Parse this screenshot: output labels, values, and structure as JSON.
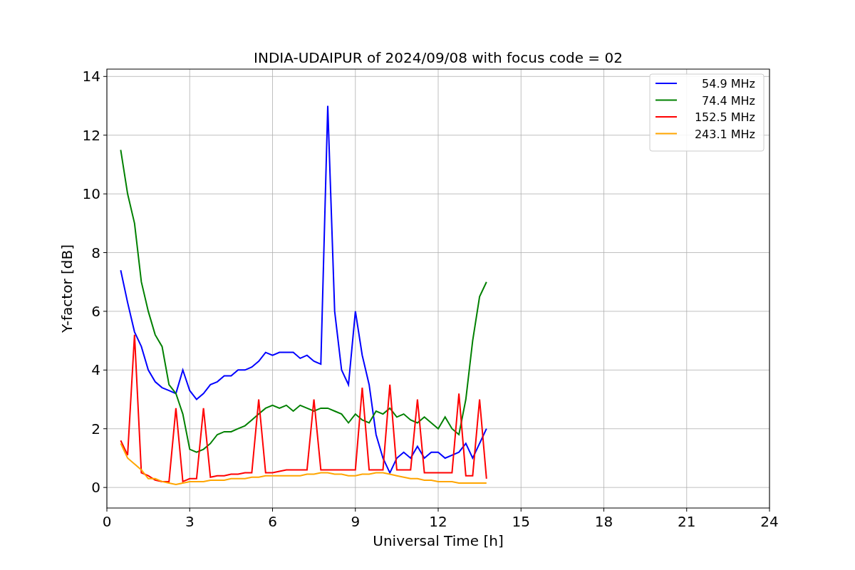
{
  "chart_data": {
    "type": "line",
    "title": "INDIA-UDAIPUR of 2024/09/08 with focus code = 02",
    "xlabel": "Universal Time [h]",
    "ylabel": "Y-factor [dB]",
    "x": [
      0.5,
      0.75,
      1.0,
      1.25,
      1.5,
      1.75,
      2.0,
      2.25,
      2.5,
      2.75,
      3.0,
      3.25,
      3.5,
      3.75,
      4.0,
      4.25,
      4.5,
      4.75,
      5.0,
      5.25,
      5.5,
      5.75,
      6.0,
      6.25,
      6.5,
      6.75,
      7.0,
      7.25,
      7.5,
      7.75,
      8.0,
      8.25,
      8.5,
      8.75,
      9.0,
      9.25,
      9.5,
      9.75,
      10.0,
      10.25,
      10.5,
      10.75,
      11.0,
      11.25,
      11.5,
      11.75,
      12.0,
      12.25,
      12.5,
      12.75,
      13.0,
      13.25,
      13.5,
      13.75
    ],
    "series": [
      {
        "name": "54.9 MHz",
        "color": "#0000ff",
        "values": [
          7.4,
          6.3,
          5.3,
          4.8,
          4.0,
          3.6,
          3.4,
          3.3,
          3.2,
          4.0,
          3.3,
          3.0,
          3.2,
          3.5,
          3.6,
          3.8,
          3.8,
          4.0,
          4.0,
          4.1,
          4.3,
          4.6,
          4.5,
          4.6,
          4.6,
          4.6,
          4.4,
          4.5,
          4.3,
          4.2,
          13.0,
          6.0,
          4.0,
          3.5,
          6.0,
          4.5,
          3.5,
          1.8,
          1.0,
          0.5,
          1.0,
          1.2,
          1.0,
          1.4,
          1.0,
          1.2,
          1.2,
          1.0,
          1.1,
          1.2,
          1.5,
          1.0,
          1.5,
          2.0
        ]
      },
      {
        "name": "74.4 MHz",
        "color": "#008000",
        "values": [
          11.5,
          10.0,
          9.0,
          7.0,
          6.0,
          5.2,
          4.8,
          3.5,
          3.2,
          2.5,
          1.3,
          1.2,
          1.3,
          1.5,
          1.8,
          1.9,
          1.9,
          2.0,
          2.1,
          2.3,
          2.5,
          2.7,
          2.8,
          2.7,
          2.8,
          2.6,
          2.8,
          2.7,
          2.6,
          2.7,
          2.7,
          2.6,
          2.5,
          2.2,
          2.5,
          2.3,
          2.2,
          2.6,
          2.5,
          2.7,
          2.4,
          2.5,
          2.3,
          2.2,
          2.4,
          2.2,
          2.0,
          2.4,
          2.0,
          1.8,
          3.0,
          5.0,
          6.5,
          7.0
        ]
      },
      {
        "name": "152.5 MHz",
        "color": "#ff0000",
        "values": [
          1.6,
          1.1,
          5.2,
          0.5,
          0.4,
          0.25,
          0.2,
          0.2,
          2.7,
          0.2,
          0.3,
          0.3,
          2.7,
          0.35,
          0.4,
          0.4,
          0.45,
          0.45,
          0.5,
          0.5,
          3.0,
          0.5,
          0.5,
          0.55,
          0.6,
          0.6,
          0.6,
          0.6,
          3.0,
          0.6,
          0.6,
          0.6,
          0.6,
          0.6,
          0.6,
          3.4,
          0.6,
          0.6,
          0.6,
          3.5,
          0.6,
          0.6,
          0.6,
          3.0,
          0.5,
          0.5,
          0.5,
          0.5,
          0.5,
          3.2,
          0.4,
          0.4,
          3.0,
          0.3
        ]
      },
      {
        "name": "243.1 MHz",
        "color": "#ffa500",
        "values": [
          1.5,
          1.0,
          0.8,
          0.6,
          0.3,
          0.3,
          0.2,
          0.15,
          0.1,
          0.15,
          0.2,
          0.2,
          0.2,
          0.25,
          0.25,
          0.25,
          0.3,
          0.3,
          0.3,
          0.35,
          0.35,
          0.4,
          0.4,
          0.4,
          0.4,
          0.4,
          0.4,
          0.45,
          0.45,
          0.5,
          0.5,
          0.45,
          0.45,
          0.4,
          0.4,
          0.45,
          0.45,
          0.5,
          0.5,
          0.45,
          0.4,
          0.35,
          0.3,
          0.3,
          0.25,
          0.25,
          0.2,
          0.2,
          0.2,
          0.15,
          0.15,
          0.15,
          0.15,
          0.15
        ]
      }
    ],
    "xlim": [
      0,
      24
    ],
    "ylim": [
      -0.7,
      14.25
    ],
    "xticks": [
      0,
      3,
      6,
      9,
      12,
      15,
      18,
      21,
      24
    ],
    "yticks": [
      0,
      2,
      4,
      6,
      8,
      10,
      12,
      14
    ],
    "grid": true,
    "legend": true
  }
}
